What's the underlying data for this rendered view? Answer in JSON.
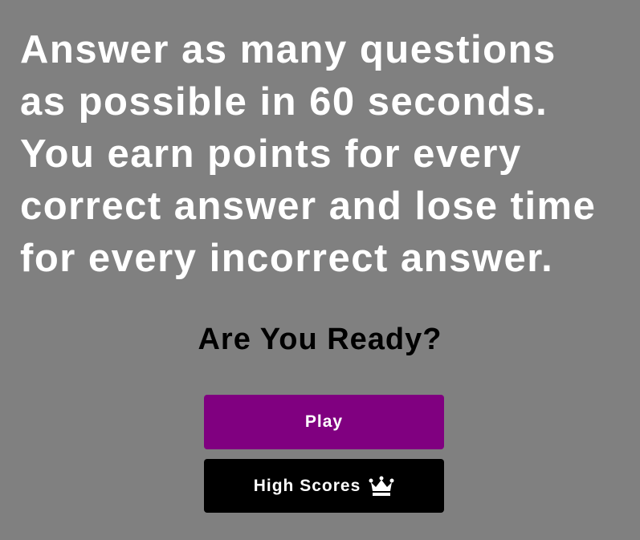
{
  "intro": {
    "lines": [
      "Answer as many questions",
      "as possible in 60 seconds.",
      "You earn points for every",
      "correct answer and lose time",
      "for every incorrect answer."
    ]
  },
  "ready_heading": "Are You Ready?",
  "buttons": {
    "play": "Play",
    "high_scores": "High Scores",
    "high_scores_icon": "crown-icon"
  },
  "colors": {
    "background": "#808080",
    "play": "#800080",
    "high_scores": "#000000"
  }
}
